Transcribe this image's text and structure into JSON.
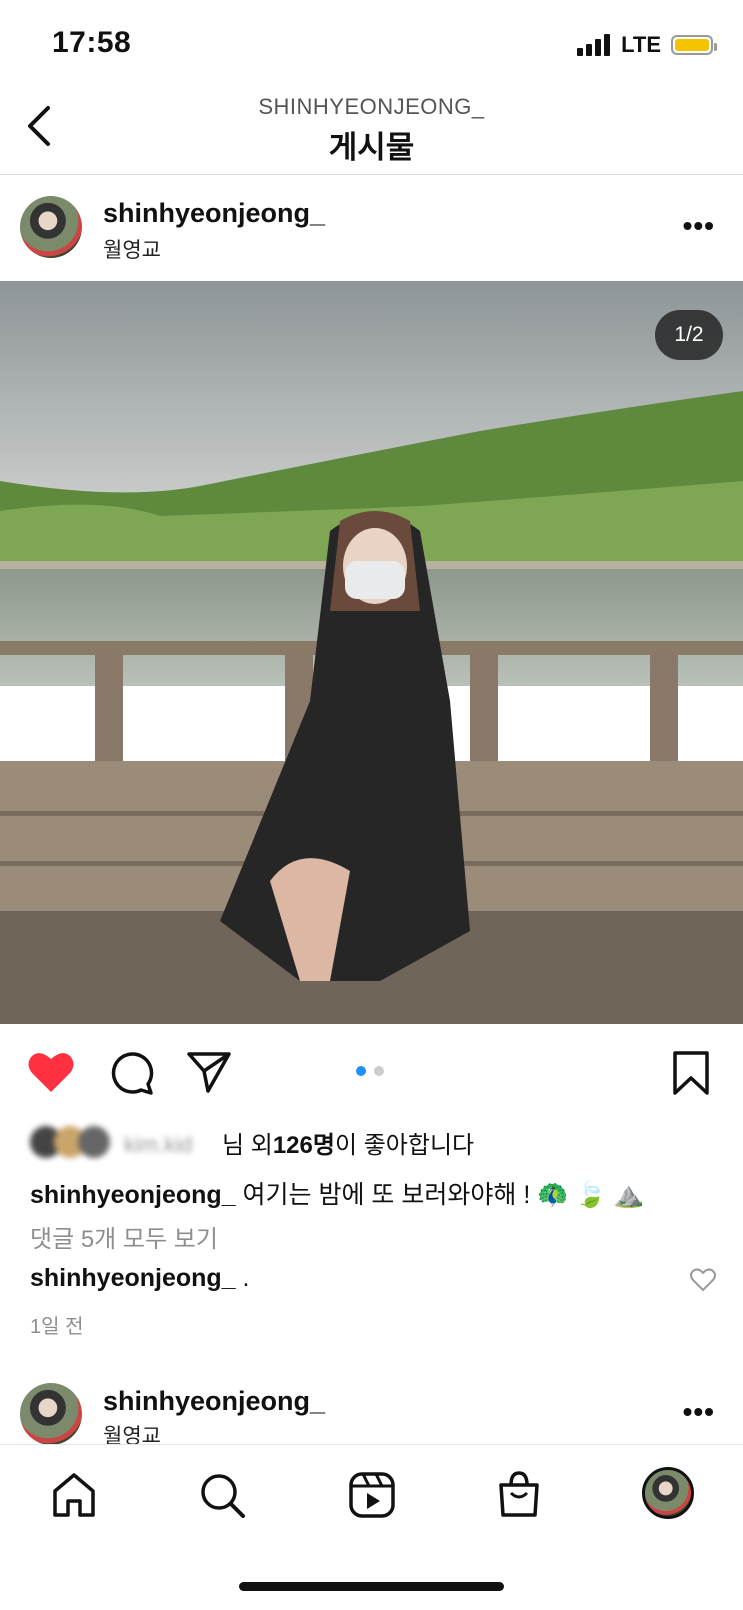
{
  "status_bar": {
    "time": "17:58",
    "network": "LTE",
    "battery_color": "#f5c400"
  },
  "header": {
    "account": "SHINHYEONJEONG_",
    "title": "게시물"
  },
  "post": {
    "username": "shinhyeonjeong_",
    "location": "월영교",
    "counter": "1/2",
    "liked": true,
    "like_color": "#ff3040",
    "likes_prefix": "님 외 ",
    "likes_count": "126명",
    "likes_suffix": "이 좋아합니다",
    "blurred_liker": "kim.kid",
    "caption_user": "shinhyeonjeong_",
    "caption_text": " 여기는 밤에 또 보러와야해 ! 🦚 🍃 ⛰️",
    "view_comments": "댓글 5개 모두 보기",
    "comment_user": "shinhyeonjeong_",
    "comment_text": " .",
    "time_ago": "1일 전"
  },
  "next_post": {
    "username": "shinhyeonjeong_",
    "location": "월영교"
  },
  "tab_bar": {
    "items": [
      "home-icon",
      "search-icon",
      "reels-icon",
      "shop-icon",
      "profile-avatar"
    ]
  }
}
